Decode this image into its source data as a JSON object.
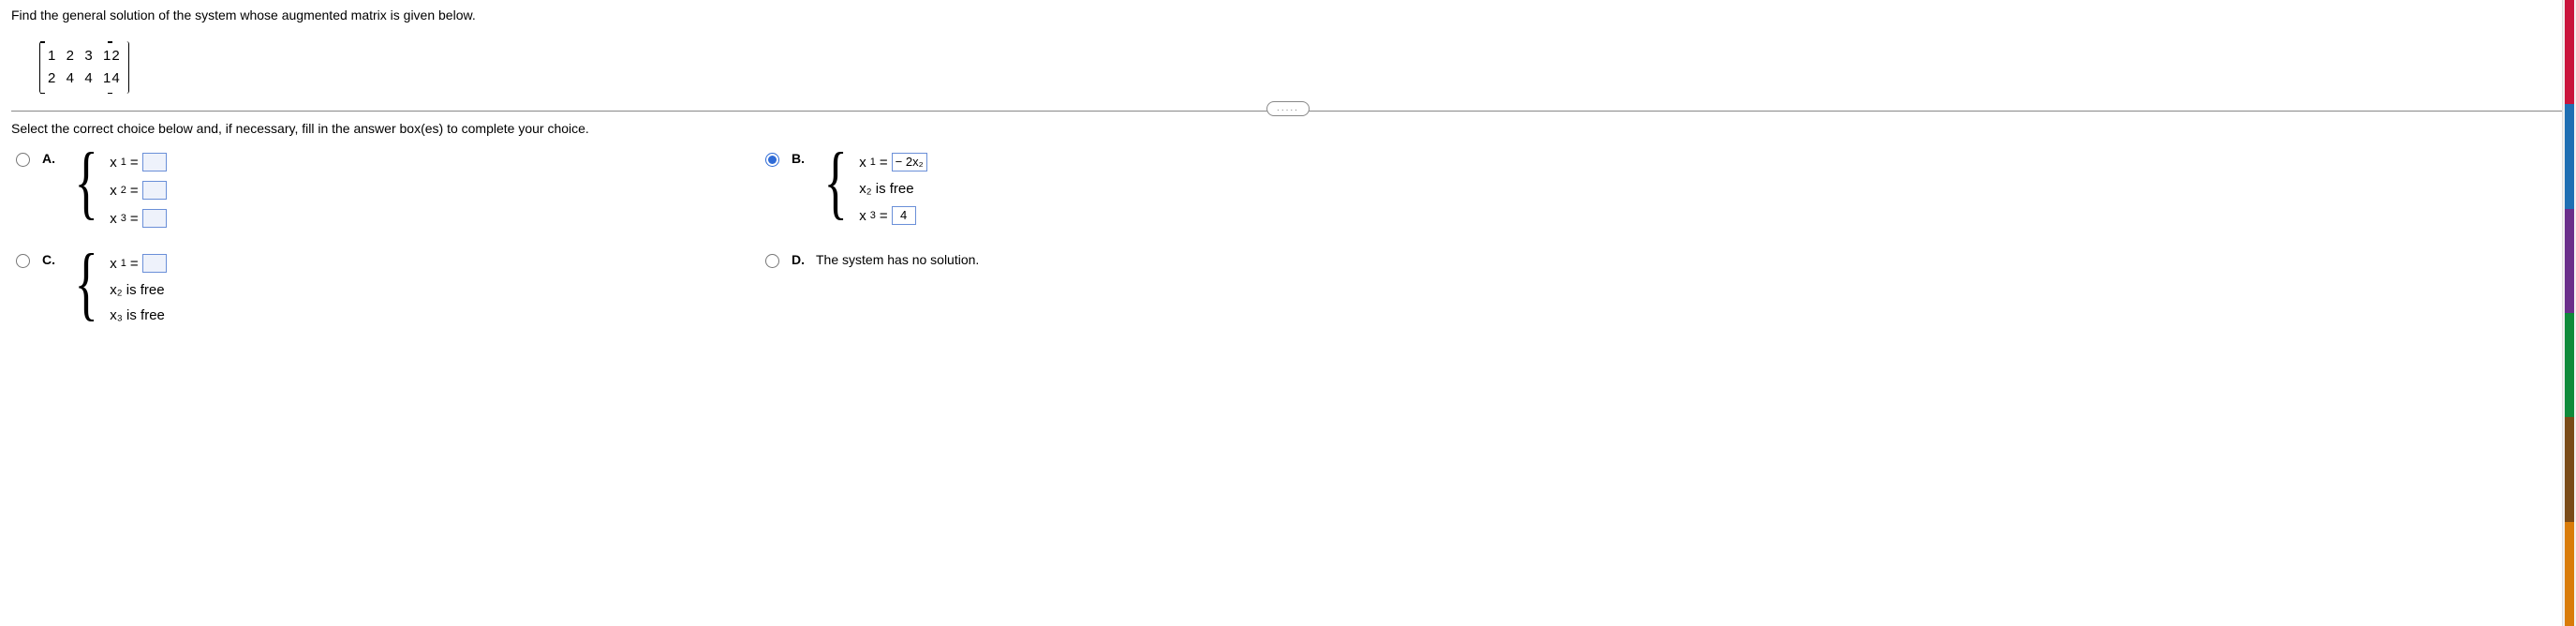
{
  "prompt": "Find the general solution of the system whose augmented matrix is given below.",
  "matrix": {
    "row1": "1  2  3  12",
    "row2": "2  4  4  14"
  },
  "divider_label": ".....",
  "instructions": "Select the correct choice below and, if necessary, fill in the answer box(es) to complete your choice.",
  "choices": {
    "A": {
      "label": "A.",
      "rows": {
        "r1_lhs": "x",
        "r1_sub": "1",
        "r1_eq": " = ",
        "r1_val": "",
        "r2_lhs": "x",
        "r2_sub": "2",
        "r2_eq": " = ",
        "r2_val": "",
        "r3_lhs": "x",
        "r3_sub": "3",
        "r3_eq": " = ",
        "r3_val": ""
      }
    },
    "B": {
      "label": "B.",
      "rows": {
        "r1_lhs": "x",
        "r1_sub": "1",
        "r1_eq": " = ",
        "r1_val": "− 2x₂",
        "r2_text": "x₂ is free",
        "r3_lhs": "x",
        "r3_sub": "3",
        "r3_eq": " = ",
        "r3_val": "4"
      }
    },
    "C": {
      "label": "C.",
      "rows": {
        "r1_lhs": "x",
        "r1_sub": "1",
        "r1_eq": " = ",
        "r1_val": "",
        "r2_text": "x₂ is free",
        "r3_text": "x₃ is free"
      }
    },
    "D": {
      "label": "D.",
      "text": "The system has no solution."
    }
  }
}
